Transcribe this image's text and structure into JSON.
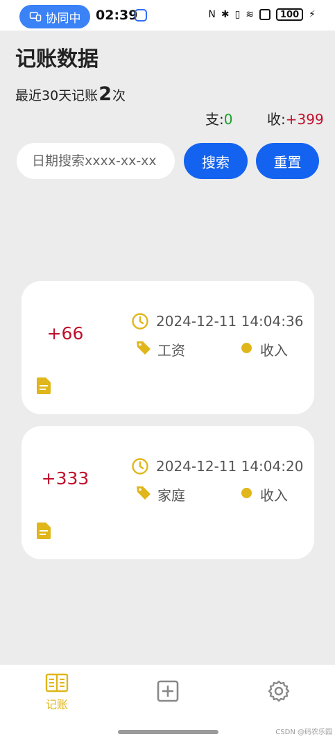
{
  "status_bar": {
    "collab_label": "协同中",
    "time": "02:39",
    "battery": "100"
  },
  "header": {
    "title": "记账数据",
    "summary_prefix": "最近30天记账",
    "summary_count": "2",
    "summary_suffix": "次",
    "expense_label": "支:",
    "expense_value": "0",
    "income_label": "收:",
    "income_value": "+399"
  },
  "search": {
    "placeholder": "日期搜索xxxx-xx-xx",
    "search_label": "搜索",
    "reset_label": "重置"
  },
  "records": [
    {
      "amount": "+66",
      "datetime": "2024-12-11 14:04:36",
      "category": "工资",
      "type": "收入"
    },
    {
      "amount": "+333",
      "datetime": "2024-12-11 14:04:20",
      "category": "家庭",
      "type": "收入"
    }
  ],
  "nav": {
    "ledger_label": "记账"
  },
  "watermark": "CSDN @码农乐园",
  "colors": {
    "primary": "#1463f0",
    "accent": "#e0b61a",
    "income": "#c0102b",
    "expense": "#1a9d2a"
  }
}
